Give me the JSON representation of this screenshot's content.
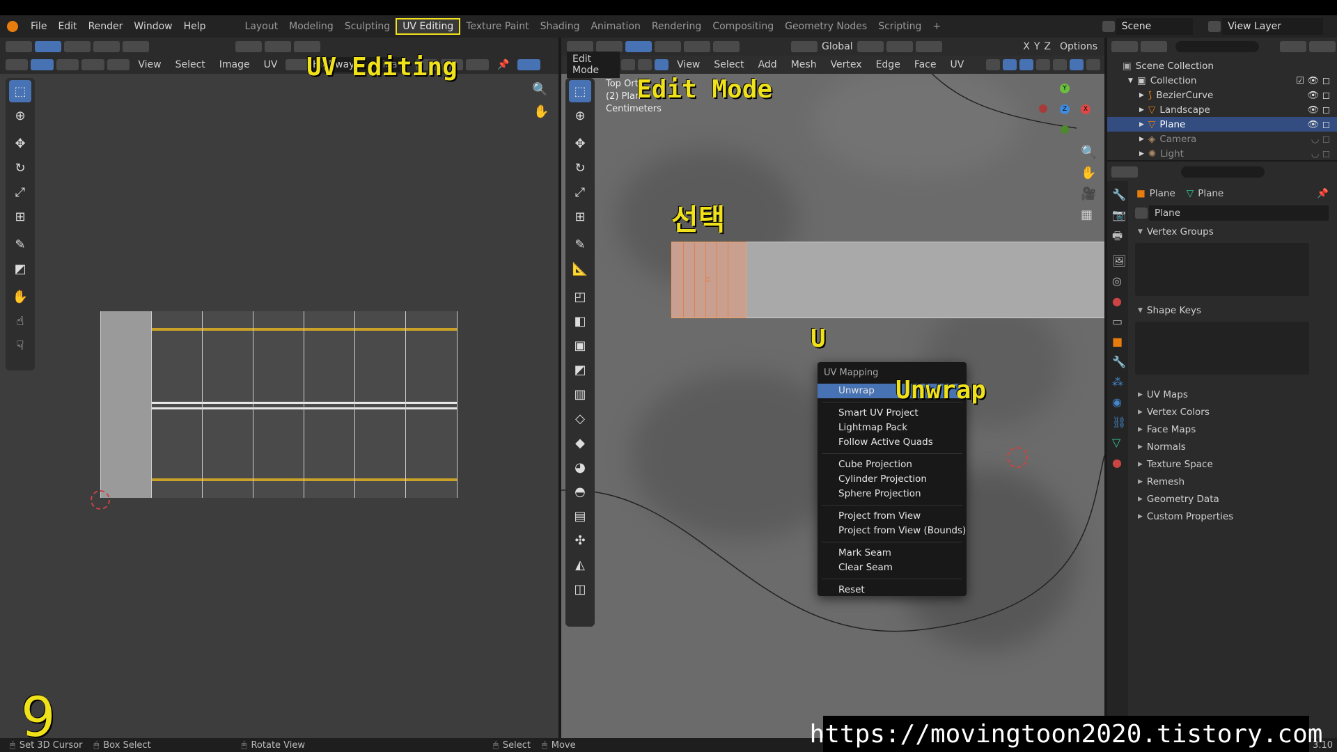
{
  "menubar": {
    "items": [
      "File",
      "Edit",
      "Render",
      "Window",
      "Help"
    ],
    "workspaces": [
      "Layout",
      "Modeling",
      "Sculpting",
      "UV Editing",
      "Texture Paint",
      "Shading",
      "Animation",
      "Rendering",
      "Compositing",
      "Geometry Nodes",
      "Scripting"
    ],
    "active_workspace": "UV Editing",
    "add_tab": "+",
    "scene_label": "Scene",
    "view_layer_label": "View Layer"
  },
  "uv_editor": {
    "menus": [
      "View",
      "Select",
      "Image",
      "UV"
    ],
    "image_name": "Highway",
    "image_name_suffix": "lea"
  },
  "viewport": {
    "mode": "Edit Mode",
    "menus": [
      "View",
      "Select",
      "Add",
      "Mesh",
      "Vertex",
      "Edge",
      "Face",
      "UV"
    ],
    "orientation": "Global",
    "axes": [
      "X",
      "Y",
      "Z"
    ],
    "options": "Options",
    "overlay_line1": "Top Orth",
    "overlay_line2": "(2) Plan",
    "overlay_line3": "Centimeters",
    "gizmo": {
      "x": "X",
      "y": "Y",
      "z": "Z"
    }
  },
  "context_menu": {
    "title": "UV Mapping",
    "groups": [
      [
        "Unwrap",
        "Smart UV Project",
        "Lightmap Pack",
        "Follow Active Quads"
      ],
      [
        "Cube Projection",
        "Cylinder Projection",
        "Sphere Projection"
      ],
      [
        "Project from View",
        "Project from View (Bounds)"
      ],
      [
        "Mark Seam",
        "Clear Seam"
      ],
      [
        "Reset"
      ]
    ],
    "highlighted": "Unwrap"
  },
  "outliner": {
    "root": "Scene Collection",
    "collection": "Collection",
    "items": [
      {
        "name": "BezierCurve",
        "selected": false,
        "dim": false
      },
      {
        "name": "Landscape",
        "selected": false,
        "dim": false
      },
      {
        "name": "Plane",
        "selected": true,
        "dim": false
      },
      {
        "name": "Camera",
        "selected": false,
        "dim": true
      },
      {
        "name": "Light",
        "selected": false,
        "dim": true
      }
    ]
  },
  "properties": {
    "breadcrumb_object": "Plane",
    "breadcrumb_data": "Plane",
    "mesh_name": "Plane",
    "panels_open": [
      "Vertex Groups",
      "Shape Keys"
    ],
    "panels_closed": [
      "UV Maps",
      "Vertex Colors",
      "Face Maps",
      "Normals",
      "Texture Space",
      "Remesh",
      "Geometry Data",
      "Custom Properties"
    ]
  },
  "annotations": {
    "uv_editing": "UV Editing",
    "edit_mode": "Edit Mode",
    "select": "선택",
    "key_u": "U",
    "unwrap": "Unwrap",
    "step": "9"
  },
  "statusbar": {
    "items": [
      "Set 3D Cursor",
      "Box Select",
      "Rotate View",
      "Select",
      "Move"
    ],
    "version": "3.10"
  },
  "watermark": "https://movingtoon2020.tistory.com",
  "colors": {
    "accent": "#4772b3",
    "annotation": "#f0e21a",
    "selection": "#f0a060"
  }
}
